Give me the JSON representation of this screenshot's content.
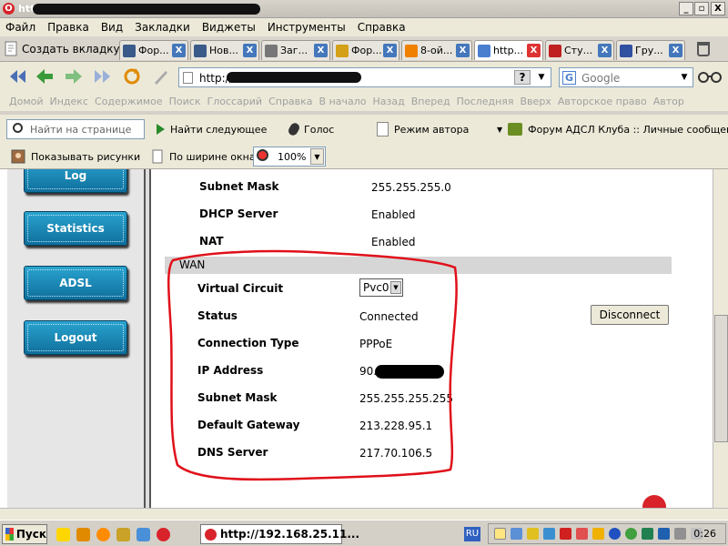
{
  "window": {
    "title": "http",
    "controls": [
      "_",
      "▫",
      "X"
    ]
  },
  "menu": [
    "Файл",
    "Правка",
    "Вид",
    "Закладки",
    "Виджеты",
    "Инструменты",
    "Справка"
  ],
  "tabs": {
    "new_tab_label": "Создать вкладку",
    "items": [
      {
        "label": "Фор...",
        "color": "#3a5a8a"
      },
      {
        "label": "Нов...",
        "color": "#3a5a8a"
      },
      {
        "label": "Заг...",
        "color": "#777777"
      },
      {
        "label": "Фор...",
        "color": "#d4a017"
      },
      {
        "label": "8-ой...",
        "color": "#f08000"
      },
      {
        "label": "http...",
        "color": "#4a7fd0"
      },
      {
        "label": "Сту...",
        "color": "#c02020"
      },
      {
        "label": "Гру...",
        "color": "#3050a0"
      }
    ],
    "close_glyph": "X"
  },
  "navbar": {
    "address_prefix": "http://",
    "help_glyph": "?",
    "search_engine_letter": "G",
    "search_placeholder": "Google"
  },
  "links_bar": [
    "Домой",
    "Индекс",
    "Содержимое",
    "Поиск",
    "Глоссарий",
    "Справка",
    "В начало",
    "Назад",
    "Вперед",
    "Последняя",
    "Вверх",
    "Авторское право",
    "Автор"
  ],
  "findbar": {
    "find_placeholder": "Найти на странице",
    "find_next": "Найти следующее",
    "voice": "Голос",
    "author_mode": "Режим автора",
    "forum_link": "Форум АДСЛ Клуба :: Личные сообщения"
  },
  "imgbar": {
    "show_images": "Показывать рисунки",
    "fit_width": "По ширине окна",
    "zoom": "100%"
  },
  "sidebar": {
    "buttons": [
      "Log",
      "Statistics",
      "ADSL",
      "Logout"
    ]
  },
  "lan": {
    "rows": [
      {
        "label": "Subnet Mask",
        "value": "255.255.255.0"
      },
      {
        "label": "DHCP Server",
        "value": "Enabled"
      },
      {
        "label": "NAT",
        "value": "Enabled"
      }
    ]
  },
  "wan": {
    "header": "WAN",
    "virtual_circuit_label": "Virtual Circuit",
    "virtual_circuit_value": "Pvc0",
    "disconnect_label": "Disconnect",
    "rows": [
      {
        "label": "Status",
        "value": "Connected"
      },
      {
        "label": "Connection Type",
        "value": "PPPoE"
      },
      {
        "label": "IP Address",
        "value": "90."
      },
      {
        "label": "Subnet Mask",
        "value": "255.255.255.255"
      },
      {
        "label": "Default Gateway",
        "value": "213.228.95.1"
      },
      {
        "label": "DNS Server",
        "value": "217.70.106.5"
      }
    ]
  },
  "annotation_color": "#e0101a",
  "taskbar": {
    "start_label": "Пуск",
    "task_label": "http://192.168.25.11...",
    "lang": "RU",
    "clock": "0:26"
  }
}
